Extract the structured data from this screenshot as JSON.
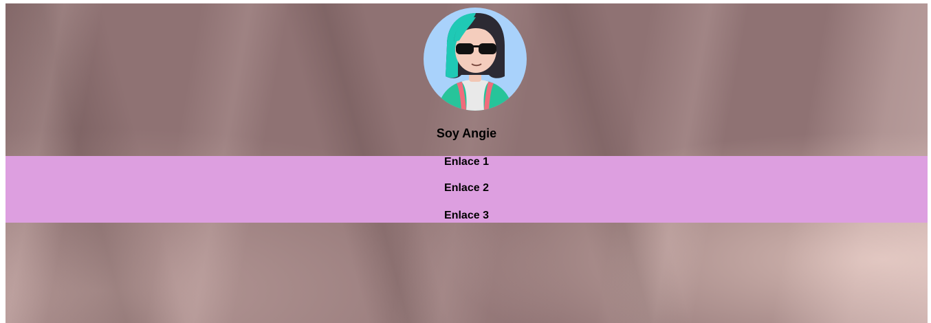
{
  "colors": {
    "background": "#8f7273",
    "nav_background": "#dd9fe0",
    "avatar_background": "#a9d2fb",
    "text": "#000000"
  },
  "profile": {
    "avatar_icon": "avatar-girl-sunglasses-icon",
    "title": "Soy Angie"
  },
  "nav": {
    "links": [
      {
        "label": "Enlace 1"
      },
      {
        "label": "Enlace 2"
      },
      {
        "label": "Enlace 3"
      }
    ]
  }
}
